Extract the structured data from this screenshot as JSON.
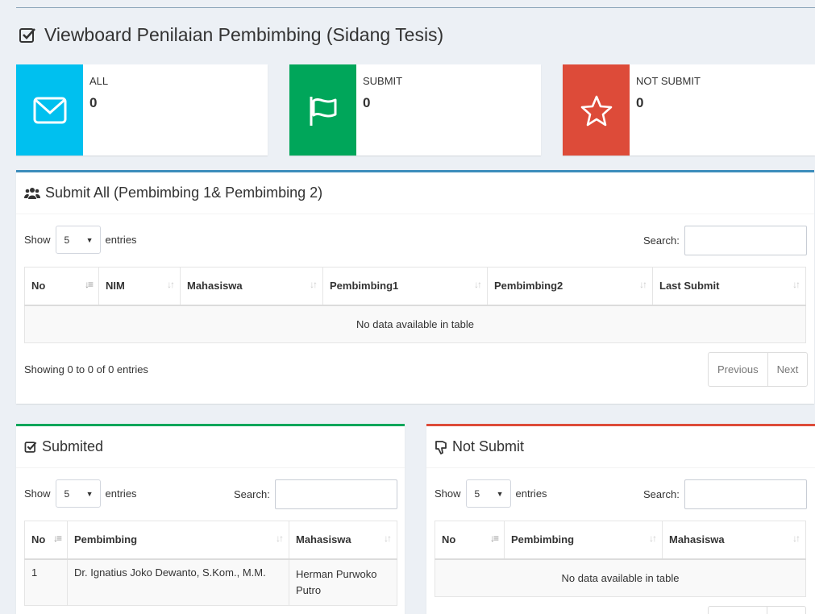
{
  "page": {
    "title": "Viewboard Penilaian Pembimbing (Sidang Tesis)"
  },
  "info_boxes": [
    {
      "label": "ALL",
      "value": "0",
      "color": "#00c0ef",
      "icon": "envelope-icon"
    },
    {
      "label": "SUBMIT",
      "value": "0",
      "color": "#00a65a",
      "icon": "flag-icon"
    },
    {
      "label": "NOT SUBMIT",
      "value": "0",
      "color": "#dd4b39",
      "icon": "star-icon"
    }
  ],
  "submit_all": {
    "title": "Submit All (Pembimbing 1& Pembimbing 2)",
    "show": "Show",
    "length": "5",
    "entries": "entries",
    "search_label": "Search:",
    "columns": [
      "No",
      "NIM",
      "Mahasiswa",
      "Pembimbing1",
      "Pembimbing2",
      "Last Submit"
    ],
    "empty": "No data available in table",
    "info": "Showing 0 to 0 of 0 entries",
    "prev": "Previous",
    "next": "Next",
    "accent": "#3c8dbc"
  },
  "submited": {
    "title": "Submited",
    "show": "Show",
    "length": "5",
    "entries": "entries",
    "search_label": "Search:",
    "columns": [
      "No",
      "Pembimbing",
      "Mahasiswa"
    ],
    "rows": [
      {
        "no": "1",
        "pembimbing": "Dr. Ignatius Joko Dewanto, S.Kom., M.M.",
        "mahasiswa": "Herman Purwoko Putro"
      }
    ],
    "accent": "#00a65a"
  },
  "not_submit": {
    "title": "Not Submit",
    "show": "Show",
    "length": "5",
    "entries": "entries",
    "search_label": "Search:",
    "columns": [
      "No",
      "Pembimbing",
      "Mahasiswa"
    ],
    "empty": "No data available in table",
    "accent": "#dd4b39"
  }
}
